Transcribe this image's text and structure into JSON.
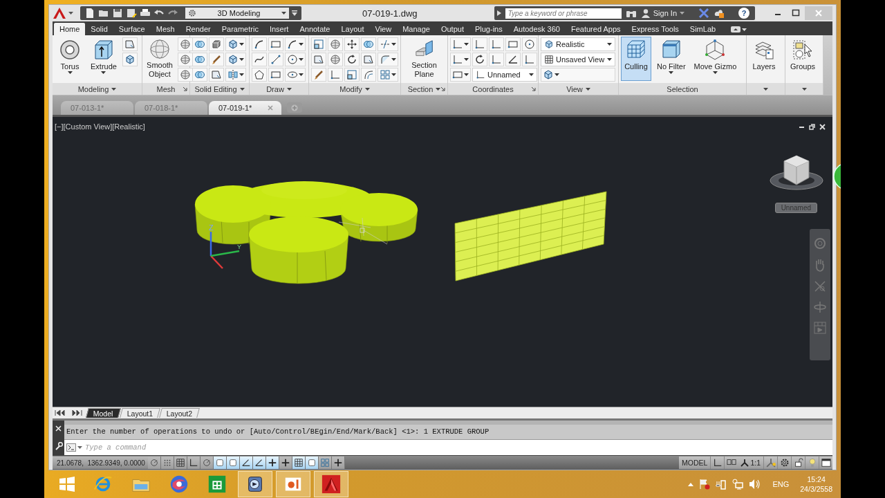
{
  "window": {
    "title": "07-019-1.dwg",
    "workspace": "3D Modeling",
    "search_placeholder": "Type a keyword or phrase",
    "sign_in": "Sign In",
    "help": "?"
  },
  "ribbon_tabs": [
    {
      "label": "Home",
      "selected": true
    },
    {
      "label": "Solid",
      "selected": false
    },
    {
      "label": "Surface",
      "selected": false
    },
    {
      "label": "Mesh",
      "selected": false
    },
    {
      "label": "Render",
      "selected": false
    },
    {
      "label": "Parametric",
      "selected": false
    },
    {
      "label": "Insert",
      "selected": false
    },
    {
      "label": "Annotate",
      "selected": false
    },
    {
      "label": "Layout",
      "selected": false
    },
    {
      "label": "View",
      "selected": false
    },
    {
      "label": "Manage",
      "selected": false
    },
    {
      "label": "Output",
      "selected": false
    },
    {
      "label": "Plug-ins",
      "selected": false
    },
    {
      "label": "Autodesk 360",
      "selected": false
    },
    {
      "label": "Featured Apps",
      "selected": false
    },
    {
      "label": "Express Tools",
      "selected": false
    },
    {
      "label": "SimLab",
      "selected": false
    }
  ],
  "ribbon_panels": [
    {
      "kind": "modeling",
      "title": "Modeling",
      "buttons": [
        {
          "label": "Torus"
        },
        {
          "label": "Extrude"
        }
      ]
    },
    {
      "kind": "mesh",
      "title": "Mesh",
      "buttons": [
        {
          "label": "Smooth Object"
        }
      ]
    },
    {
      "kind": "solid",
      "title": "Solid Editing"
    },
    {
      "kind": "draw",
      "title": "Draw"
    },
    {
      "kind": "modify",
      "title": "Modify"
    },
    {
      "kind": "section",
      "title": "Section",
      "buttons": [
        {
          "label": "Section Plane"
        }
      ]
    },
    {
      "kind": "coordinates",
      "title": "Coordinates",
      "dropdowns": [
        "Unnamed"
      ]
    },
    {
      "kind": "view",
      "title": "View",
      "dropdowns": [
        "Realistic",
        "Unsaved View"
      ]
    },
    {
      "kind": "selection",
      "title": "Selection",
      "buttons": [
        {
          "label": "Culling",
          "on": true
        },
        {
          "label": "No Filter",
          "on": false
        },
        {
          "label": "Move Gizmo",
          "on": false
        }
      ]
    },
    {
      "kind": "layers",
      "buttons": [
        {
          "label": "Layers"
        }
      ]
    },
    {
      "kind": "groups",
      "buttons": [
        {
          "label": "Groups"
        }
      ]
    }
  ],
  "file_tabs": [
    {
      "label": "07-013-1*",
      "selected": false
    },
    {
      "label": "07-018-1*",
      "selected": false
    },
    {
      "label": "07-019-1*",
      "selected": true
    }
  ],
  "viewport": {
    "label": "[−][Custom View][Realistic]",
    "view_name": "Unnamed",
    "ucs_labels": [
      "Z",
      "Y"
    ]
  },
  "layout_tabs": [
    {
      "label": "Model",
      "selected": true
    },
    {
      "label": "Layout1",
      "selected": false
    },
    {
      "label": "Layout2",
      "selected": false
    }
  ],
  "command_line": {
    "history": "Enter the number of operations to undo or [Auto/Control/BEgin/End/Mark/Back] <1>: 1 EXTRUDE GROUP",
    "placeholder": "Type a command"
  },
  "status_bar": {
    "coordinates": "21.0678,  1362.9349, 0.0000",
    "mode": "MODEL",
    "scale": "1:1",
    "toggles": [
      {
        "on": false
      },
      {
        "on": false
      },
      {
        "on": false
      },
      {
        "on": false
      },
      {
        "on": false
      },
      {
        "on": true
      },
      {
        "on": true
      },
      {
        "on": true
      },
      {
        "on": true
      },
      {
        "on": true
      },
      {
        "on": false
      },
      {
        "on": true
      },
      {
        "on": true
      },
      {
        "on": false
      },
      {
        "on": false
      }
    ]
  },
  "taskbar": {
    "apps": [
      {
        "running": false
      },
      {
        "running": false
      },
      {
        "running": false
      },
      {
        "running": false
      },
      {
        "running": true
      },
      {
        "running": true
      },
      {
        "running": true
      }
    ],
    "language": "ENG",
    "time": "15:24",
    "date": "24/3/2558"
  }
}
